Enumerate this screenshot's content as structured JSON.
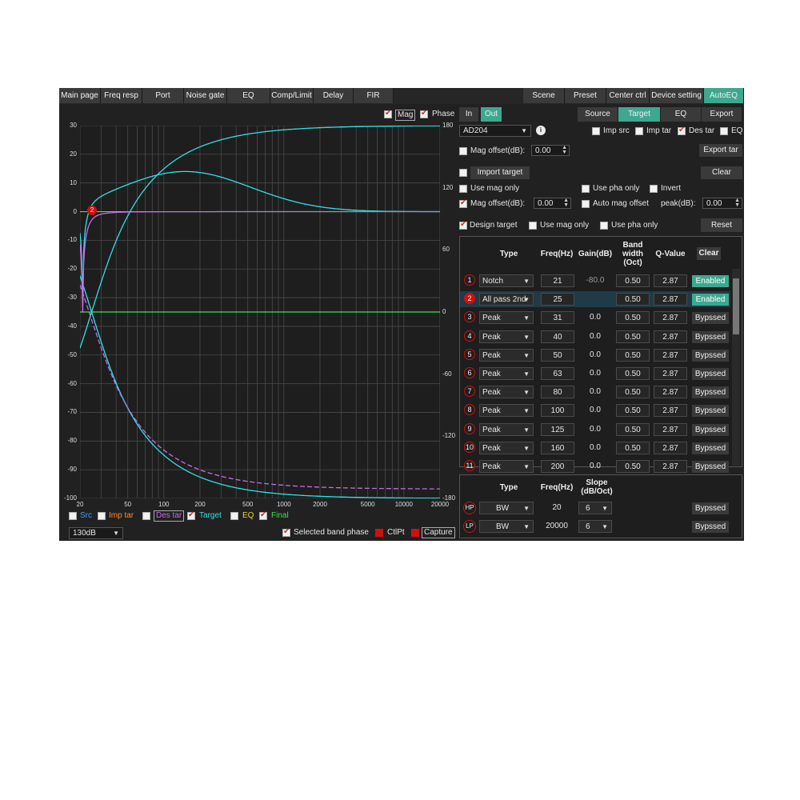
{
  "nav": {
    "left_tabs": [
      "Main page",
      "Freq resp",
      "Port",
      "Noise gate",
      "EQ",
      "Comp/Limit",
      "Delay",
      "FIR"
    ],
    "right_tabs": [
      "Scene",
      "Preset",
      "Center ctrl",
      "Device setting",
      "AutoEQ"
    ],
    "active": "AutoEQ"
  },
  "graph": {
    "mag_label": "Mag",
    "phase_label": "Phase",
    "mag_checked": true,
    "phase_checked": true,
    "left_ticks": [
      "30",
      "20",
      "10",
      "0",
      "-10",
      "-20",
      "-30",
      "-40",
      "-50",
      "-60",
      "-70",
      "-80",
      "-90",
      "-100"
    ],
    "right_ticks": [
      "180",
      "120",
      "60",
      "0",
      "-60",
      "-120",
      "-180"
    ],
    "x_ticks": [
      "20",
      "50",
      "100",
      "200",
      "500",
      "1000",
      "2000",
      "5000",
      "10000",
      "20000"
    ],
    "band_marker": "2"
  },
  "legend": {
    "items": [
      {
        "label": "Src",
        "color": "#3aa0ff",
        "checked": false
      },
      {
        "label": "Imp tar",
        "color": "#ff8a2a",
        "checked": false
      },
      {
        "label": "Des tar",
        "color": "#c86be6",
        "checked": false
      },
      {
        "label": "Target",
        "color": "#30e0e8",
        "checked": true
      },
      {
        "label": "EQ",
        "color": "#e8d43a",
        "checked": false
      },
      {
        "label": "Final",
        "color": "#3de24a",
        "checked": true
      }
    ],
    "range_value": "130dB",
    "selected_band_phase": "Selected band phase",
    "ctlpt": "CtlPt",
    "capture": "Capture"
  },
  "io": {
    "in": "In",
    "out": "Out",
    "active": "Out"
  },
  "right_tabs": {
    "items": [
      "Source",
      "Target",
      "EQ",
      "Export"
    ],
    "active": "Target"
  },
  "controls": {
    "device": "AD204",
    "imp_src": "Imp src",
    "imp_tar": "Imp tar",
    "des_tar": "Des tar",
    "eq": "EQ",
    "mag_offset_label": "Mag offset(dB):",
    "mag_offset_value": "0.00",
    "export_tar": "Export tar",
    "import_target": "Import target",
    "clear": "Clear",
    "use_mag_only": "Use mag only",
    "use_pha_only": "Use pha only",
    "invert": "Invert",
    "mag_offset2_label": "Mag offset(dB):",
    "mag_offset2_value": "0.00",
    "auto_mag_offset": "Auto mag offset",
    "peak_label": "peak(dB):",
    "peak_value": "0.00",
    "design_target": "Design target",
    "use_mag_only2": "Use mag only",
    "use_pha_only2": "Use pha only",
    "reset": "Reset"
  },
  "bands": {
    "headers": {
      "type": "Type",
      "freq": "Freq(Hz)",
      "gain": "Gain(dB)",
      "bw1": "Band",
      "bw2": "width",
      "bw3": "(Oct)",
      "q": "Q-Value",
      "clear": "Clear"
    },
    "rows": [
      {
        "n": "1",
        "type": "Notch",
        "freq": "21",
        "gain": "-80.0",
        "bw": "0.50",
        "q": "2.87",
        "status": "Enabled"
      },
      {
        "n": "2",
        "type": "All pass 2nd",
        "freq": "25",
        "gain": "",
        "bw": "0.50",
        "q": "2.87",
        "status": "Enabled"
      },
      {
        "n": "3",
        "type": "Peak",
        "freq": "31",
        "gain": "0.0",
        "bw": "0.50",
        "q": "2.87",
        "status": "Bypssed"
      },
      {
        "n": "4",
        "type": "Peak",
        "freq": "40",
        "gain": "0.0",
        "bw": "0.50",
        "q": "2.87",
        "status": "Bypssed"
      },
      {
        "n": "5",
        "type": "Peak",
        "freq": "50",
        "gain": "0.0",
        "bw": "0.50",
        "q": "2.87",
        "status": "Bypssed"
      },
      {
        "n": "6",
        "type": "Peak",
        "freq": "63",
        "gain": "0.0",
        "bw": "0.50",
        "q": "2.87",
        "status": "Bypssed"
      },
      {
        "n": "7",
        "type": "Peak",
        "freq": "80",
        "gain": "0.0",
        "bw": "0.50",
        "q": "2.87",
        "status": "Bypssed"
      },
      {
        "n": "8",
        "type": "Peak",
        "freq": "100",
        "gain": "0.0",
        "bw": "0.50",
        "q": "2.87",
        "status": "Bypssed"
      },
      {
        "n": "9",
        "type": "Peak",
        "freq": "125",
        "gain": "0.0",
        "bw": "0.50",
        "q": "2.87",
        "status": "Bypssed"
      },
      {
        "n": "10",
        "type": "Peak",
        "freq": "160",
        "gain": "0.0",
        "bw": "0.50",
        "q": "2.87",
        "status": "Bypssed"
      },
      {
        "n": "11",
        "type": "Peak",
        "freq": "200",
        "gain": "0.0",
        "bw": "0.50",
        "q": "2.87",
        "status": "Bypssed"
      }
    ]
  },
  "filters": {
    "headers": {
      "type": "Type",
      "freq": "Freq(Hz)",
      "slope1": "Slope",
      "slope2": "(dB/Oct)"
    },
    "rows": [
      {
        "n": "HP",
        "type": "BW",
        "freq": "20",
        "slope": "6",
        "status": "Byпssed"
      },
      {
        "n": "LP",
        "type": "BW",
        "freq": "20000",
        "slope": "6",
        "status": "Bypssed"
      }
    ]
  }
}
